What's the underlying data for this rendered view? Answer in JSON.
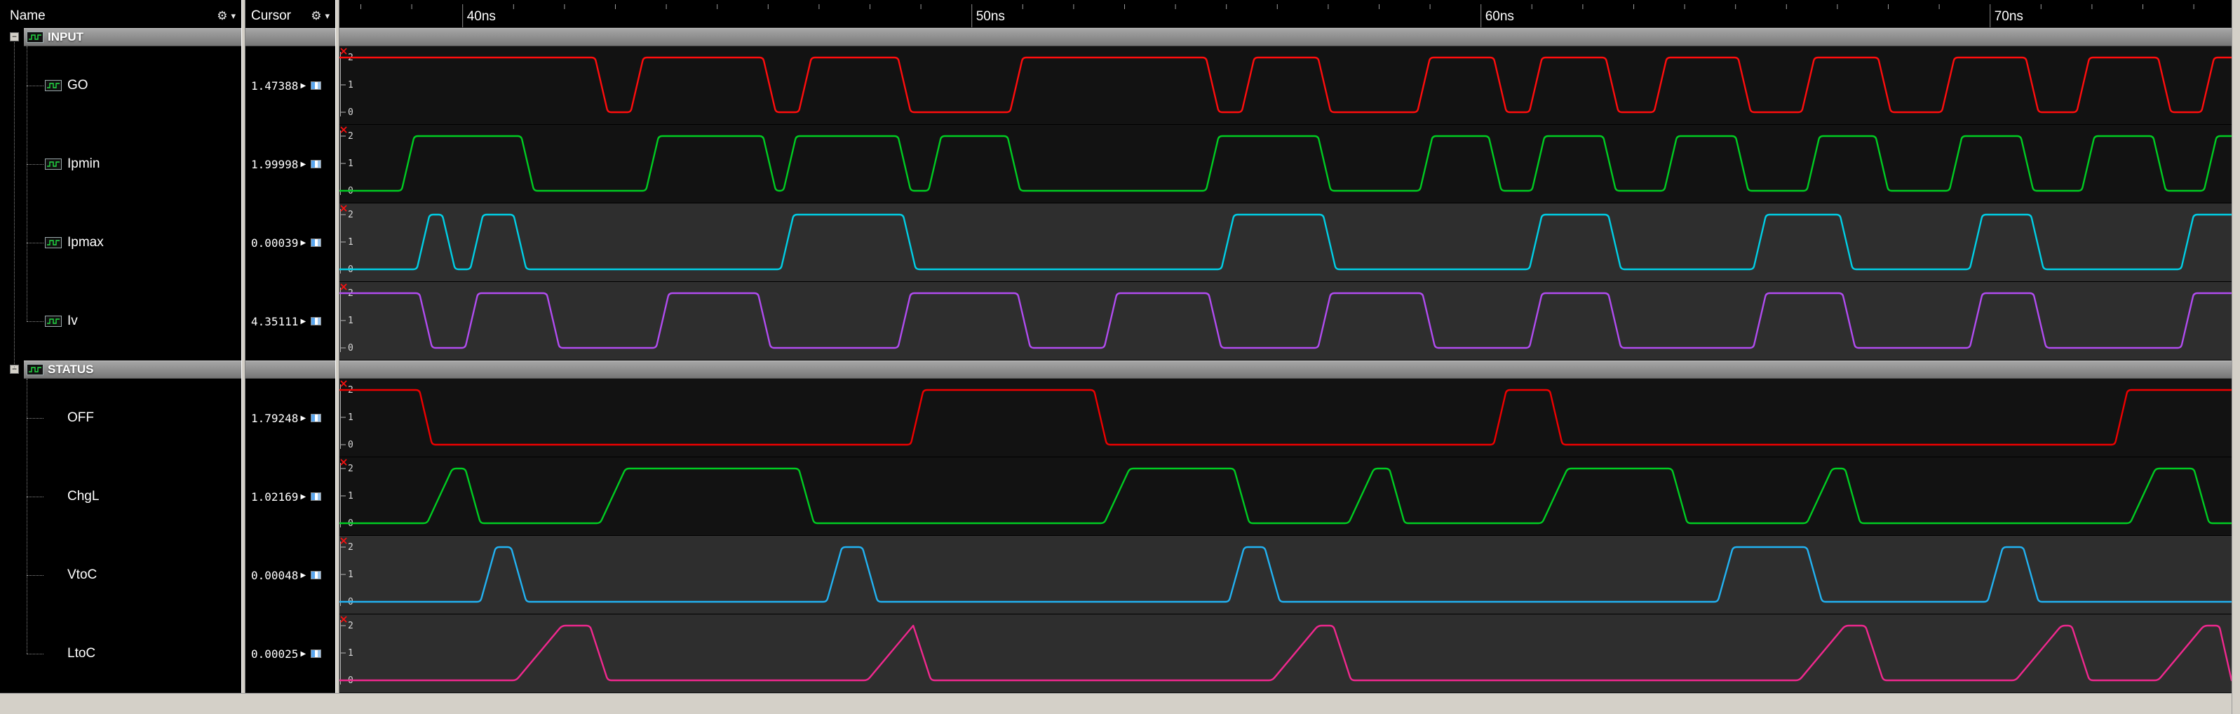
{
  "name_panel": {
    "header": "Name"
  },
  "cursor_panel": {
    "header": "Cursor"
  },
  "icons": {
    "gear": "⚙",
    "dropdown_arrow": "▾",
    "collapse": "−",
    "cursor_expand_arrow": "▶"
  },
  "timeline": {
    "unit": "ns",
    "start_ns": 37.58,
    "end_ns": 74.74,
    "minor_tick_step_ns": 1,
    "major_ticks": [
      {
        "t": 40,
        "label": "40ns"
      },
      {
        "t": 50,
        "label": "50ns"
      },
      {
        "t": 60,
        "label": "60ns"
      },
      {
        "t": 70,
        "label": "70ns"
      }
    ]
  },
  "groups": [
    {
      "label": "INPUT",
      "icon": "group-wave-icon",
      "signals": [
        {
          "name": "GO",
          "icon": "net-icon",
          "color": "#ff0d0d",
          "cursor_value": "1.47388",
          "axis_labels": [
            "2",
            "1",
            "0"
          ],
          "wave": {
            "initial": 2,
            "edge_rise_ns": 0.25,
            "edge_fall_ns": 0.25,
            "toggles_ns": [
              42.6,
              43.3,
              45.9,
              46.6,
              48.55,
              50.75,
              54.6,
              55.3,
              56.8,
              58.75,
              60.25,
              60.95,
              62.45,
              63.4,
              65.05,
              66.3,
              67.8,
              69.05,
              70.7,
              71.7,
              73.3,
              74.15
            ]
          }
        },
        {
          "name": "Ipmin",
          "icon": "net-icon",
          "color": "#00cc22",
          "cursor_value": "1.99998",
          "axis_labels": [
            "2",
            "1",
            "0"
          ],
          "wave": {
            "initial": 0,
            "edge_rise_ns": 0.25,
            "edge_fall_ns": 0.25,
            "toggles_ns": [
              38.8,
              41.15,
              43.6,
              45.9,
              46.3,
              48.55,
              49.15,
              50.7,
              54.6,
              56.8,
              58.8,
              60.15,
              61.0,
              62.4,
              63.6,
              65.0,
              66.4,
              67.75,
              69.2,
              70.6,
              71.8,
              73.2,
              74.2
            ]
          }
        },
        {
          "name": "Ipmax",
          "icon": "net-icon",
          "color": "#00cfe6",
          "cursor_value": "0.00039",
          "axis_labels": [
            "2",
            "1",
            "0"
          ],
          "wave": {
            "initial": 0,
            "edge_rise_ns": 0.25,
            "edge_fall_ns": 0.25,
            "toggles_ns": [
              39.1,
              39.6,
              40.15,
              41.0,
              46.25,
              48.65,
              54.9,
              56.9,
              60.95,
              62.5,
              65.35,
              67.05,
              69.6,
              70.8,
              73.75
            ]
          }
        },
        {
          "name": "Iv",
          "icon": "net-icon",
          "color": "#b14cf0",
          "cursor_value": "4.35111",
          "axis_labels": [
            "2",
            "1",
            "0"
          ],
          "wave": {
            "initial": 2,
            "edge_rise_ns": 0.25,
            "edge_fall_ns": 0.25,
            "toggles_ns": [
              39.15,
              40.05,
              41.65,
              43.8,
              45.8,
              48.55,
              50.9,
              52.6,
              54.65,
              56.8,
              58.85,
              60.95,
              62.5,
              65.35,
              67.1,
              69.6,
              70.85,
              73.75
            ]
          }
        }
      ]
    },
    {
      "label": "STATUS",
      "icon": "group-wave-icon",
      "signals": [
        {
          "name": "OFF",
          "color": "#ee0000",
          "cursor_value": "1.79248",
          "axis_labels": [
            "2",
            "1",
            "0"
          ],
          "wave": {
            "initial": 2,
            "edge_rise_ns": 0.25,
            "edge_fall_ns": 0.25,
            "toggles_ns": [
              39.15,
              48.8,
              52.4,
              60.25,
              61.35,
              72.45
            ]
          }
        },
        {
          "name": "ChgL",
          "color": "#00cc22",
          "cursor_value": "1.02169",
          "axis_labels": [
            "2",
            "1",
            "0"
          ],
          "wave": {
            "initial": 0,
            "edge_rise_ns": 0.5,
            "edge_fall_ns": 0.3,
            "toggles_ns": [
              39.3,
              40.05,
              42.7,
              46.6,
              52.6,
              55.15,
              57.4,
              58.2,
              61.2,
              63.75,
              66.4,
              67.15,
              72.75,
              74.0
            ]
          }
        },
        {
          "name": "VtoC",
          "color": "#22b2f2",
          "cursor_value": "0.00048",
          "axis_labels": [
            "2",
            "1",
            "0"
          ],
          "wave": {
            "initial": 0,
            "edge_rise_ns": 0.3,
            "edge_fall_ns": 0.3,
            "toggles_ns": [
              40.35,
              40.95,
              47.15,
              47.85,
              55.05,
              55.75,
              64.65,
              66.4,
              69.95,
              70.65
            ]
          }
        },
        {
          "name": "LtoC",
          "color": "#f0288e",
          "cursor_value": "0.00025",
          "axis_labels": [
            "2",
            "1",
            "0"
          ],
          "wave": {
            "initial": 0,
            "edge_rise_ns": 0.9,
            "edge_fall_ns": 0.35,
            "toggles_ns": [
              41.05,
              42.5,
              47.95,
              48.85,
              55.9,
              57.1,
              66.25,
              67.55,
              70.5,
              71.6,
              73.3,
              74.5
            ]
          }
        }
      ]
    }
  ]
}
